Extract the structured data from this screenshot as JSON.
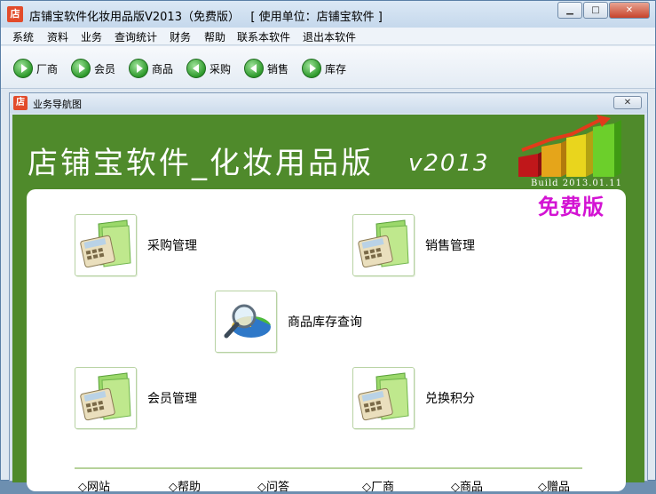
{
  "window": {
    "icon_text": "店",
    "title": "店铺宝软件化妆用品版V2013（免费版）   [ 使用单位：店铺宝软件 ]",
    "controls": {
      "minimize": "▁",
      "maximize": "□",
      "close": "✕"
    }
  },
  "menu": [
    "系统",
    "资料",
    "业务",
    "查询统计",
    "财务",
    "帮助",
    "联系本软件",
    "退出本软件"
  ],
  "toolbar": [
    {
      "label": "厂商",
      "icon": "play-right-icon"
    },
    {
      "label": "会员",
      "icon": "play-right-icon"
    },
    {
      "label": "商品",
      "icon": "play-right-icon"
    },
    {
      "label": "采购",
      "icon": "play-left-icon"
    },
    {
      "label": "销售",
      "icon": "play-left-icon"
    },
    {
      "label": "库存",
      "icon": "play-right-icon"
    }
  ],
  "child_window": {
    "icon_text": "店",
    "title": "业务导航图",
    "close": "✕"
  },
  "banner": {
    "title": "店铺宝软件_化妆用品版",
    "version": "v2013",
    "build": "Build 2013.01.11",
    "edition": "免费版"
  },
  "nav": {
    "purchase": "采购管理",
    "sales": "销售管理",
    "inventory": "商品库存查询",
    "members": "会员管理",
    "points": "兑换积分"
  },
  "footer": [
    "网站",
    "帮助",
    "问答",
    "厂商",
    "商品",
    "赠品"
  ],
  "colors": {
    "banner_green": "#4f8a2b",
    "edition_magenta": "#d313d3"
  }
}
